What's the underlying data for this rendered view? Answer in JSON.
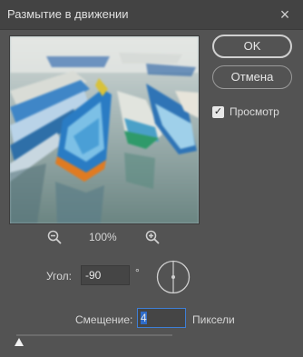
{
  "window": {
    "title": "Размытие в движении"
  },
  "buttons": {
    "ok": "OK",
    "cancel": "Отмена"
  },
  "preview_toggle": {
    "label": "Просмотр",
    "checked": true
  },
  "zoom": {
    "level": "100%"
  },
  "angle": {
    "label": "Угол:",
    "value": "-90",
    "unit": "°"
  },
  "offset": {
    "label": "Смещение:",
    "value": "4",
    "unit": "Пиксели",
    "slider_fraction": 0.02
  },
  "icons": {
    "close": "close-icon",
    "zoom_out": "zoom-out-icon",
    "zoom_in": "zoom-in-icon",
    "dial": "angle-dial-icon"
  }
}
